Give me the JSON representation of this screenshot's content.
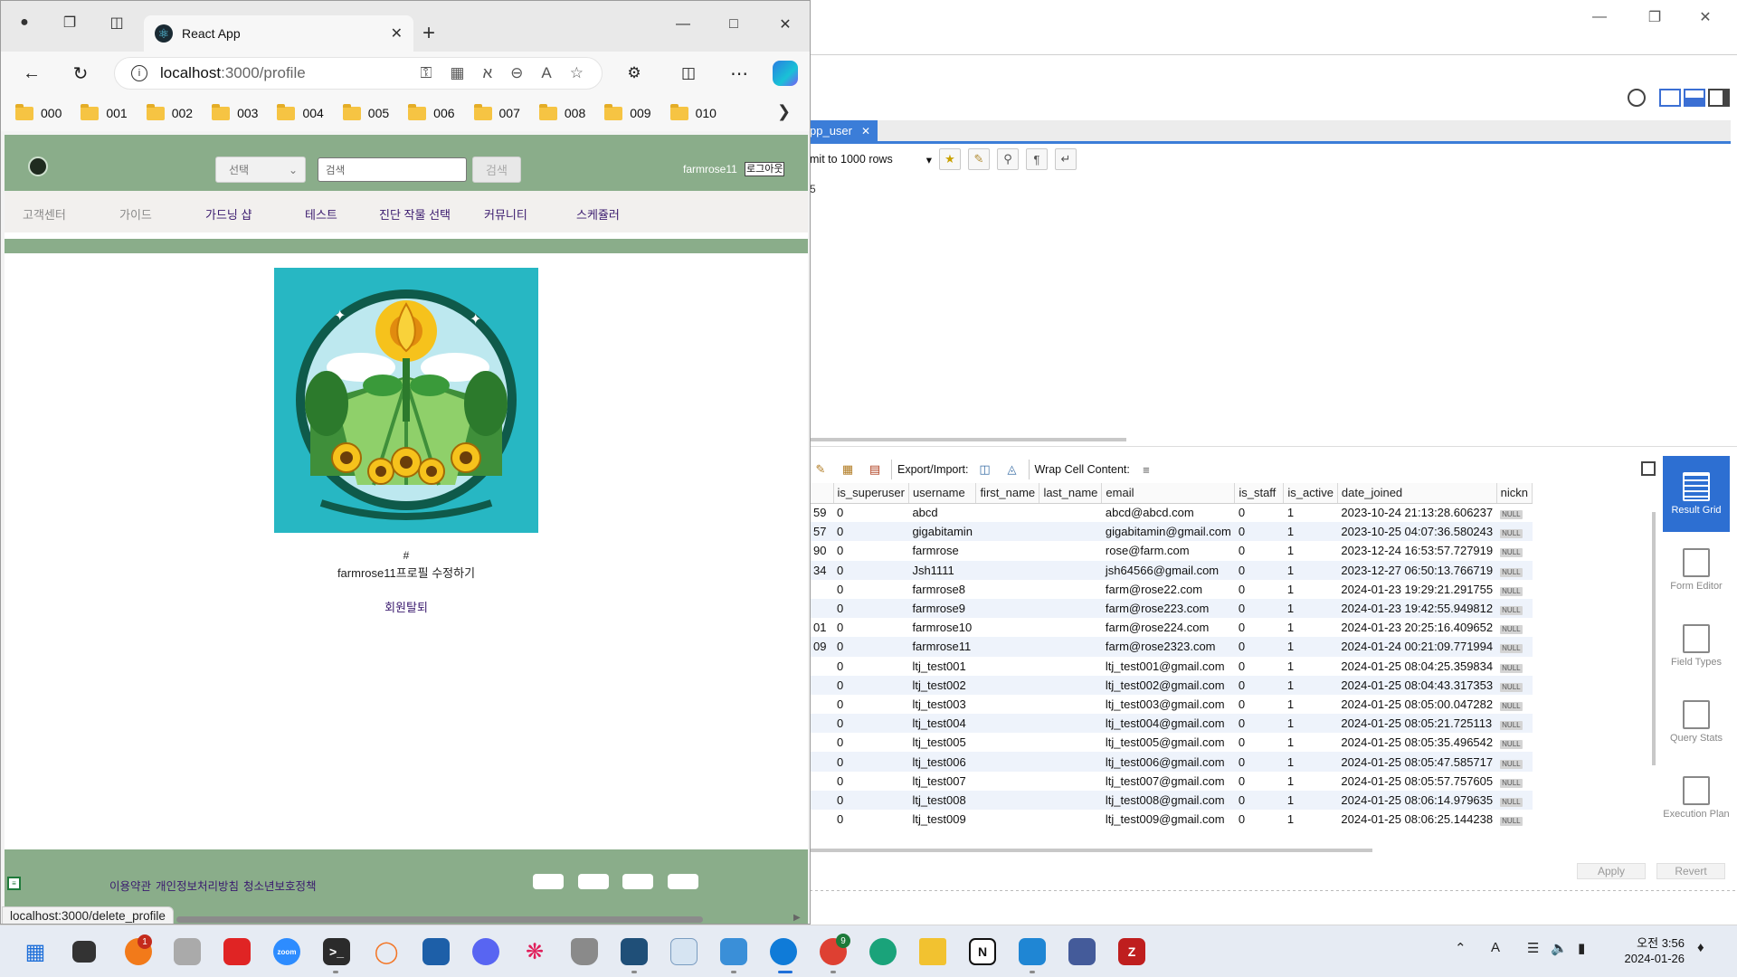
{
  "browser": {
    "tab_title": "React App",
    "url_host": "localhost",
    "url_path": ":3000/profile",
    "status_url": "localhost:3000/delete_profile",
    "bookmarks": [
      "000",
      "001",
      "002",
      "003",
      "004",
      "005",
      "006",
      "007",
      "008",
      "009",
      "010"
    ]
  },
  "app": {
    "header": {
      "select_value": "선택",
      "search_placeholder": "검색",
      "search_button": "검색",
      "username": "farmrose11",
      "logout": "로그아웃"
    },
    "nav": [
      "고객센터",
      "가이드",
      "가드닝 샵",
      "테스트",
      "진단 작물 선택",
      "커뮤니티",
      "스케쥴러"
    ],
    "profile": {
      "image_caption": "#",
      "edit_link": "farmrose11프로필 수정하기",
      "delete_link": "회원탈퇴"
    },
    "footer": {
      "links": [
        "이용약관",
        "개인정보처리방침",
        "청소년보호정책"
      ]
    }
  },
  "workbench": {
    "tab_label": "pp_user",
    "limit_label": "mit to 1000 rows",
    "editor_line": "5",
    "result_toolbar": {
      "export_label": "Export/Import:",
      "wrap_label": "Wrap Cell Content:"
    },
    "columns": [
      "",
      "is_superuser",
      "username",
      "first_name",
      "last_name",
      "email",
      "is_staff",
      "is_active",
      "date_joined",
      "nickn"
    ],
    "rows": [
      {
        "id": "59",
        "is_superuser": "0",
        "username": "abcd",
        "first_name": "",
        "last_name": "",
        "email": "abcd@abcd.com",
        "is_staff": "0",
        "is_active": "1",
        "date_joined": "2023-10-24 21:13:28.606237",
        "nick": "NULL"
      },
      {
        "id": "57",
        "is_superuser": "0",
        "username": "gigabitamin",
        "first_name": "",
        "last_name": "",
        "email": "gigabitamin@gmail.com",
        "is_staff": "0",
        "is_active": "1",
        "date_joined": "2023-10-25 04:07:36.580243",
        "nick": "NULL"
      },
      {
        "id": "90",
        "is_superuser": "0",
        "username": "farmrose",
        "first_name": "",
        "last_name": "",
        "email": "rose@farm.com",
        "is_staff": "0",
        "is_active": "1",
        "date_joined": "2023-12-24 16:53:57.727919",
        "nick": "NULL"
      },
      {
        "id": "34",
        "is_superuser": "0",
        "username": "Jsh1111",
        "first_name": "",
        "last_name": "",
        "email": "jsh64566@gmail.com",
        "is_staff": "0",
        "is_active": "1",
        "date_joined": "2023-12-27 06:50:13.766719",
        "nick": "NULL"
      },
      {
        "id": "",
        "is_superuser": "0",
        "username": "farmrose8",
        "first_name": "",
        "last_name": "",
        "email": "farm@rose22.com",
        "is_staff": "0",
        "is_active": "1",
        "date_joined": "2024-01-23 19:29:21.291755",
        "nick": "NULL"
      },
      {
        "id": "",
        "is_superuser": "0",
        "username": "farmrose9",
        "first_name": "",
        "last_name": "",
        "email": "farm@rose223.com",
        "is_staff": "0",
        "is_active": "1",
        "date_joined": "2024-01-23 19:42:55.949812",
        "nick": "NULL"
      },
      {
        "id": "01",
        "is_superuser": "0",
        "username": "farmrose10",
        "first_name": "",
        "last_name": "",
        "email": "farm@rose224.com",
        "is_staff": "0",
        "is_active": "1",
        "date_joined": "2024-01-23 20:25:16.409652",
        "nick": "NULL"
      },
      {
        "id": "09",
        "is_superuser": "0",
        "username": "farmrose11",
        "first_name": "",
        "last_name": "",
        "email": "farm@rose2323.com",
        "is_staff": "0",
        "is_active": "1",
        "date_joined": "2024-01-24 00:21:09.771994",
        "nick": "NULL"
      },
      {
        "id": "",
        "is_superuser": "0",
        "username": "ltj_test001",
        "first_name": "",
        "last_name": "",
        "email": "ltj_test001@gmail.com",
        "is_staff": "0",
        "is_active": "1",
        "date_joined": "2024-01-25 08:04:25.359834",
        "nick": "NULL"
      },
      {
        "id": "",
        "is_superuser": "0",
        "username": "ltj_test002",
        "first_name": "",
        "last_name": "",
        "email": "ltj_test002@gmail.com",
        "is_staff": "0",
        "is_active": "1",
        "date_joined": "2024-01-25 08:04:43.317353",
        "nick": "NULL"
      },
      {
        "id": "",
        "is_superuser": "0",
        "username": "ltj_test003",
        "first_name": "",
        "last_name": "",
        "email": "ltj_test003@gmail.com",
        "is_staff": "0",
        "is_active": "1",
        "date_joined": "2024-01-25 08:05:00.047282",
        "nick": "NULL"
      },
      {
        "id": "",
        "is_superuser": "0",
        "username": "ltj_test004",
        "first_name": "",
        "last_name": "",
        "email": "ltj_test004@gmail.com",
        "is_staff": "0",
        "is_active": "1",
        "date_joined": "2024-01-25 08:05:21.725113",
        "nick": "NULL"
      },
      {
        "id": "",
        "is_superuser": "0",
        "username": "ltj_test005",
        "first_name": "",
        "last_name": "",
        "email": "ltj_test005@gmail.com",
        "is_staff": "0",
        "is_active": "1",
        "date_joined": "2024-01-25 08:05:35.496542",
        "nick": "NULL"
      },
      {
        "id": "",
        "is_superuser": "0",
        "username": "ltj_test006",
        "first_name": "",
        "last_name": "",
        "email": "ltj_test006@gmail.com",
        "is_staff": "0",
        "is_active": "1",
        "date_joined": "2024-01-25 08:05:47.585717",
        "nick": "NULL"
      },
      {
        "id": "",
        "is_superuser": "0",
        "username": "ltj_test007",
        "first_name": "",
        "last_name": "",
        "email": "ltj_test007@gmail.com",
        "is_staff": "0",
        "is_active": "1",
        "date_joined": "2024-01-25 08:05:57.757605",
        "nick": "NULL"
      },
      {
        "id": "",
        "is_superuser": "0",
        "username": "ltj_test008",
        "first_name": "",
        "last_name": "",
        "email": "ltj_test008@gmail.com",
        "is_staff": "0",
        "is_active": "1",
        "date_joined": "2024-01-25 08:06:14.979635",
        "nick": "NULL"
      },
      {
        "id": "",
        "is_superuser": "0",
        "username": "ltj_test009",
        "first_name": "",
        "last_name": "",
        "email": "ltj_test009@gmail.com",
        "is_staff": "0",
        "is_active": "1",
        "date_joined": "2024-01-25 08:06:25.144238",
        "nick": "NULL"
      }
    ],
    "side_dock": [
      "Result Grid",
      "Form Editor",
      "Field Types",
      "Query Stats",
      "Execution Plan"
    ],
    "apply_label": "Apply",
    "revert_label": "Revert"
  },
  "taskbar": {
    "badge_1": "1",
    "badge_9": "9",
    "time": "오전 3:56",
    "date": "2024-01-26",
    "ime": "A"
  }
}
